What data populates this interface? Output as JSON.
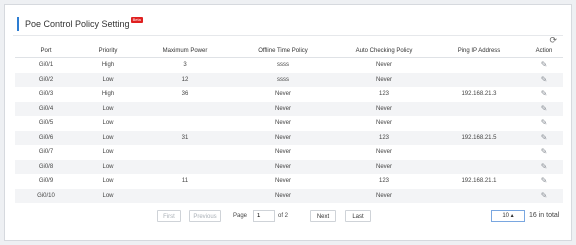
{
  "header": {
    "title": "Poe Control Policy Setting",
    "badge": "Beta"
  },
  "icons": {
    "refresh": "refresh-icon",
    "edit": "edit-icon"
  },
  "table": {
    "columns": [
      "Port",
      "Priority",
      "Maximum Power",
      "Offline Time Policy",
      "Auto Checking Policy",
      "Ping IP Address",
      "Action"
    ],
    "rows": [
      {
        "port": "Gi0/1",
        "priority": "High",
        "max_power": "3",
        "offline": "ssss",
        "auto": "Never",
        "ping": ""
      },
      {
        "port": "Gi0/2",
        "priority": "Low",
        "max_power": "12",
        "offline": "ssss",
        "auto": "Never",
        "ping": ""
      },
      {
        "port": "Gi0/3",
        "priority": "High",
        "max_power": "36",
        "offline": "Never",
        "auto": "123",
        "ping": "192.168.21.3"
      },
      {
        "port": "Gi0/4",
        "priority": "Low",
        "max_power": "",
        "offline": "Never",
        "auto": "Never",
        "ping": ""
      },
      {
        "port": "Gi0/5",
        "priority": "Low",
        "max_power": "",
        "offline": "Never",
        "auto": "Never",
        "ping": ""
      },
      {
        "port": "Gi0/6",
        "priority": "Low",
        "max_power": "31",
        "offline": "Never",
        "auto": "123",
        "ping": "192.168.21.5"
      },
      {
        "port": "Gi0/7",
        "priority": "Low",
        "max_power": "",
        "offline": "Never",
        "auto": "Never",
        "ping": ""
      },
      {
        "port": "Gi0/8",
        "priority": "Low",
        "max_power": "",
        "offline": "Never",
        "auto": "Never",
        "ping": ""
      },
      {
        "port": "Gi0/9",
        "priority": "Low",
        "max_power": "11",
        "offline": "Never",
        "auto": "123",
        "ping": "192.168.21.1"
      },
      {
        "port": "Gi0/10",
        "priority": "Low",
        "max_power": "",
        "offline": "Never",
        "auto": "Never",
        "ping": ""
      }
    ]
  },
  "pagination": {
    "first": "First",
    "previous": "Previous",
    "page_label": "Page",
    "page_value": "1",
    "of_label": "of 2",
    "next": "Next",
    "last": "Last",
    "page_size": "10 ▴",
    "total": "16 in total"
  }
}
